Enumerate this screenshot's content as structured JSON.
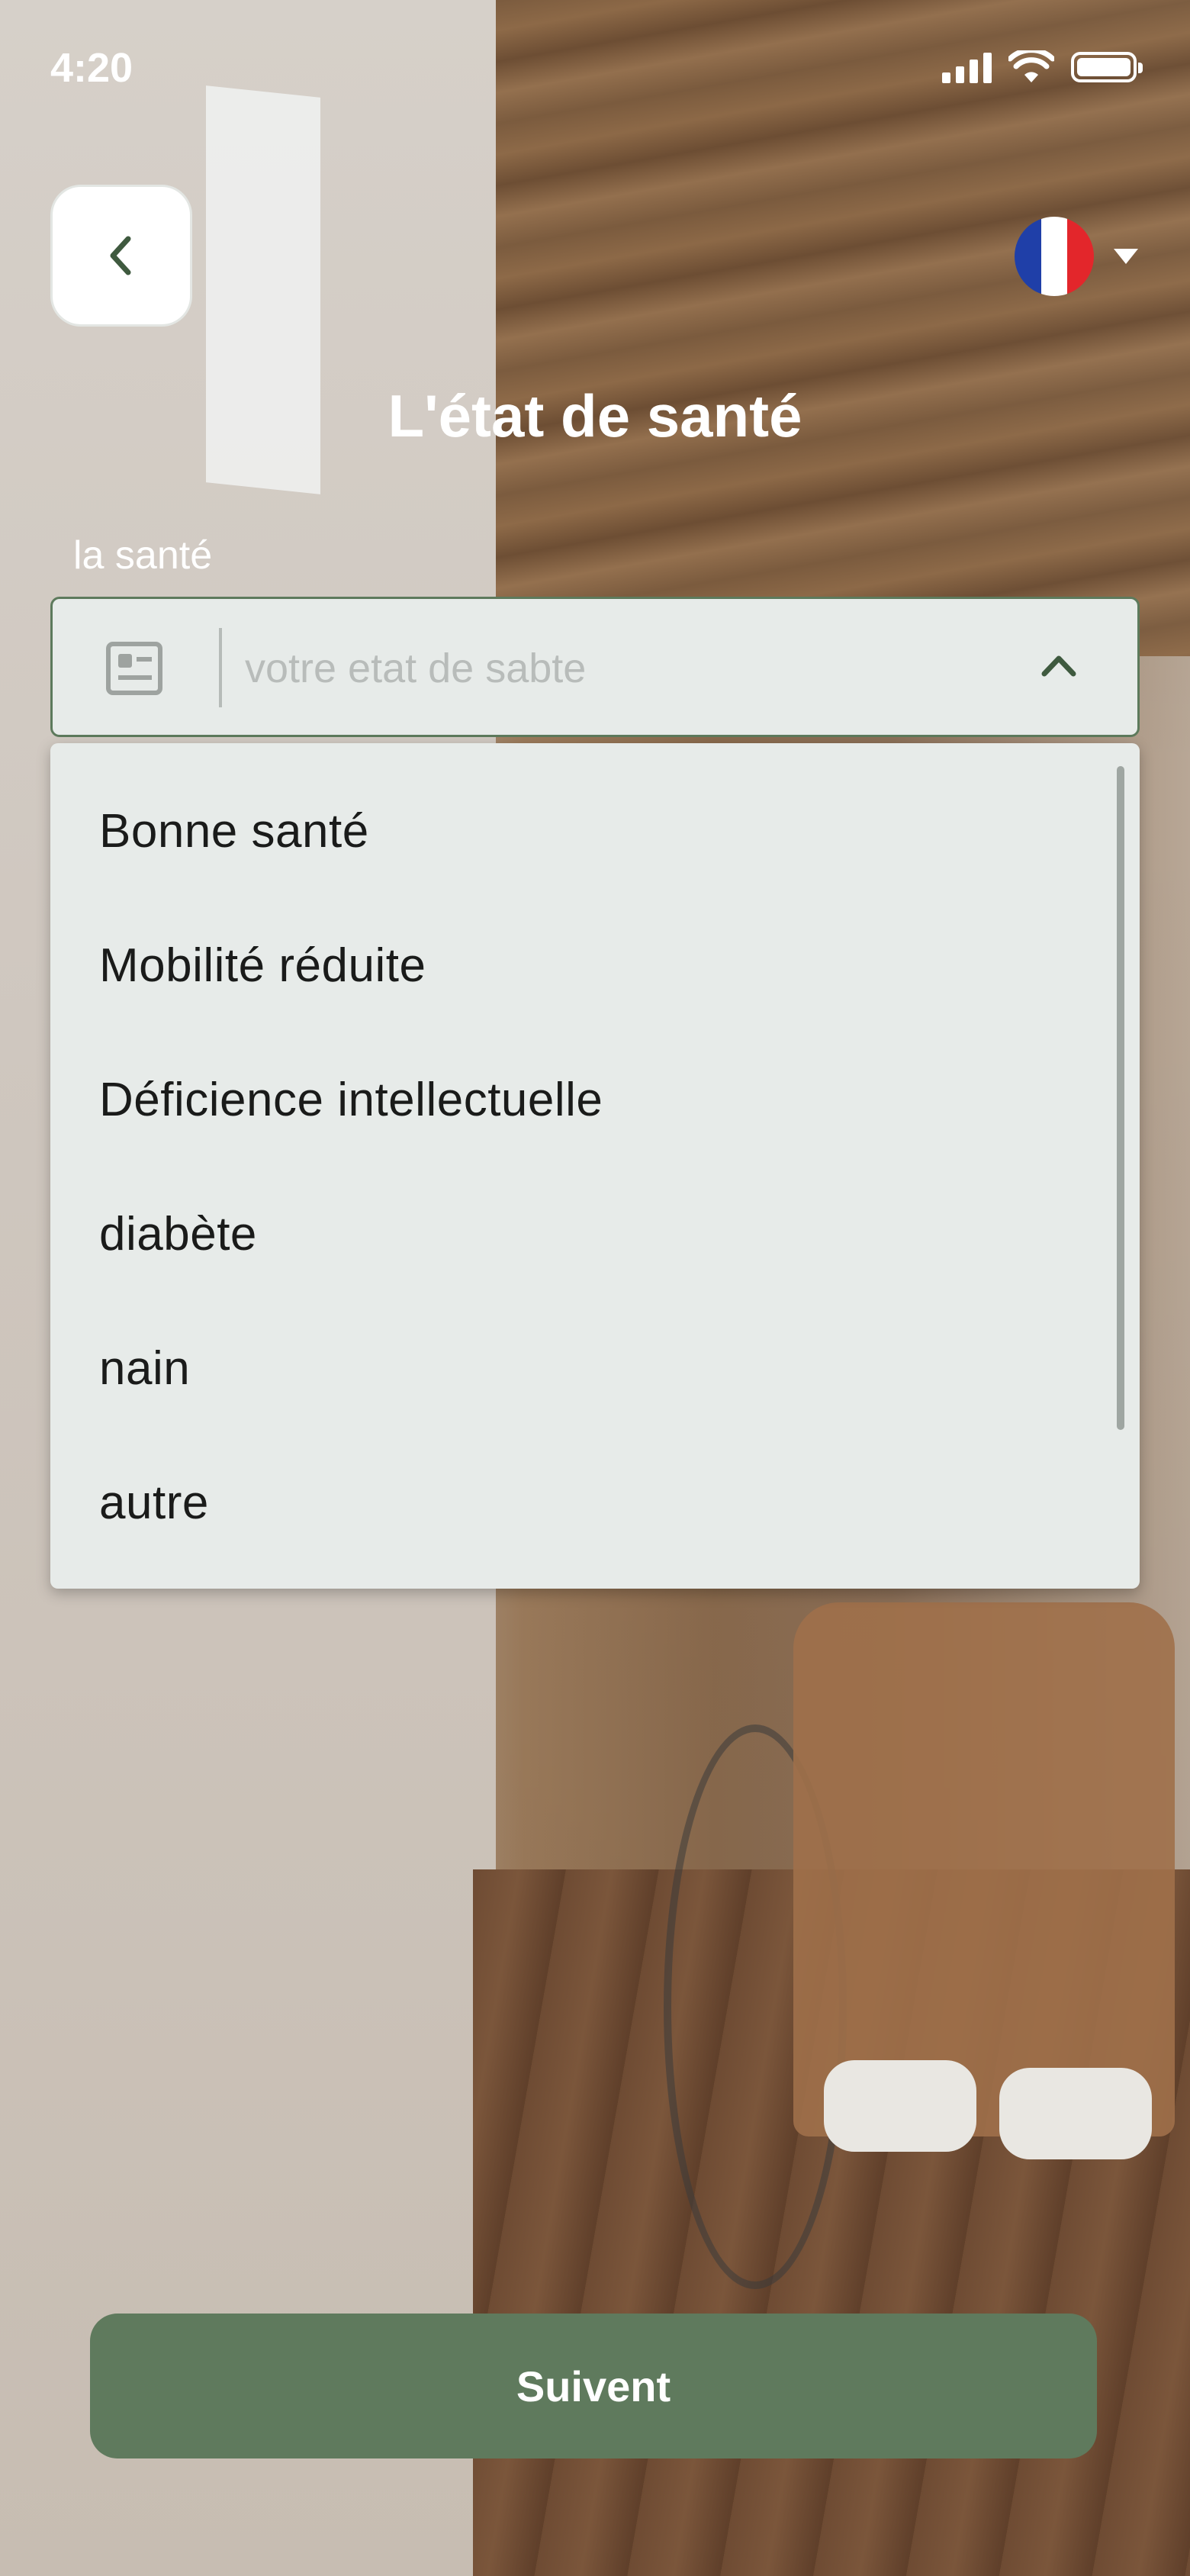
{
  "status_bar": {
    "time": "4:20"
  },
  "header": {
    "title": "L'état de santé",
    "back_icon": "chevron-left-icon",
    "language_flag": "france-flag-icon"
  },
  "form": {
    "label": "la santé",
    "placeholder": "votre etat de sabte",
    "prefix_icon": "id-card-icon",
    "toggle_icon": "chevron-up-icon",
    "options": [
      "Bonne santé",
      "Mobilité réduite",
      "Déficience intellectuelle",
      "diabète",
      "nain",
      "autre"
    ]
  },
  "actions": {
    "next_label": "Suivent"
  },
  "colors": {
    "accent": "#5f7a5d",
    "field_bg": "#e7ebe9",
    "text_dark": "#1a1b1a"
  }
}
